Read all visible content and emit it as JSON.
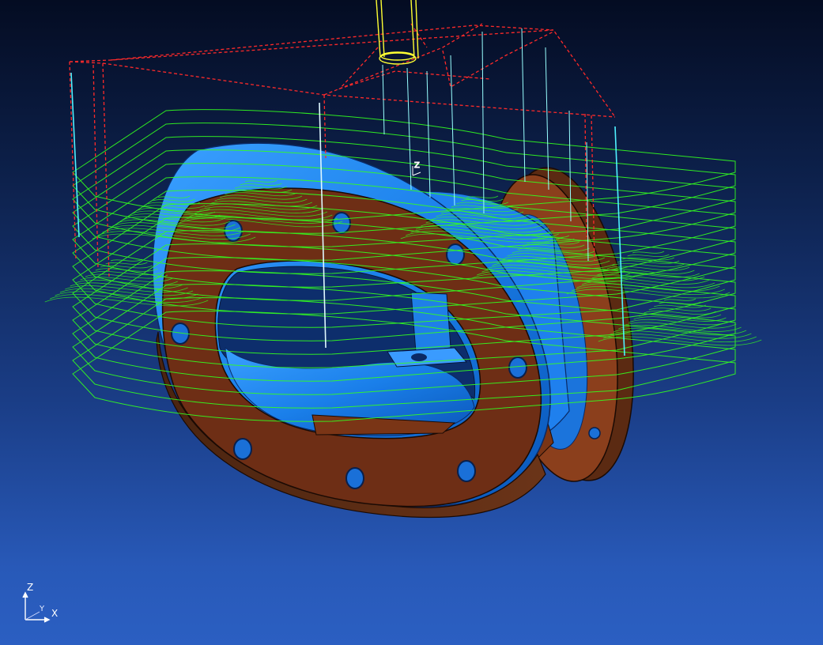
{
  "viewport": {
    "triad": {
      "z_label": "Z",
      "y_label": "Y",
      "x_label": "X"
    },
    "workplane_label": "Z"
  }
}
